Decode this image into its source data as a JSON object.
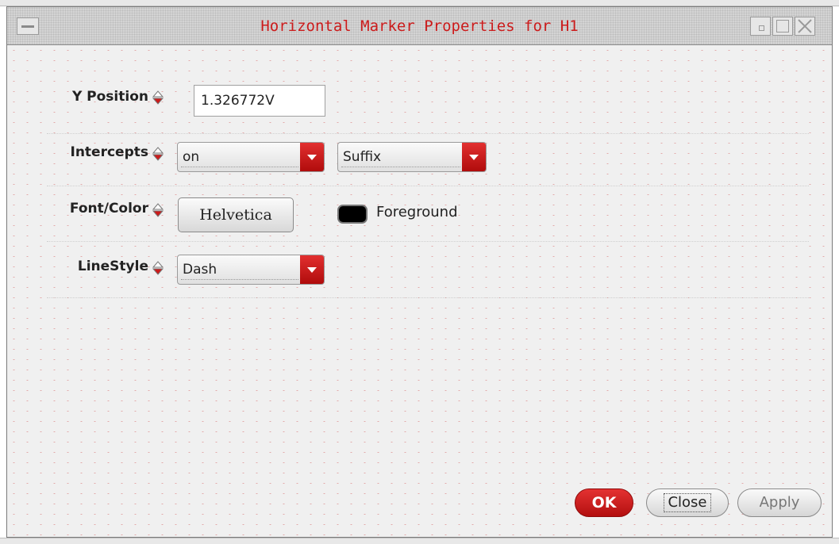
{
  "window": {
    "title": "Horizontal Marker Properties for H1"
  },
  "fields": {
    "y_position": {
      "label": "Y Position",
      "value": "1.326772V"
    },
    "intercepts": {
      "label": "Intercepts",
      "mode": "on",
      "format": "Suffix"
    },
    "font_color": {
      "label": "Font/Color",
      "font": "Helvetica",
      "color_name": "Foreground",
      "color_hex": "#000000"
    },
    "line_style": {
      "label": "LineStyle",
      "value": "Dash"
    }
  },
  "buttons": {
    "ok": "OK",
    "close": "Close",
    "apply": "Apply"
  },
  "colors": {
    "accent": "#cc1b1b",
    "panel": "#f0f0f0"
  }
}
